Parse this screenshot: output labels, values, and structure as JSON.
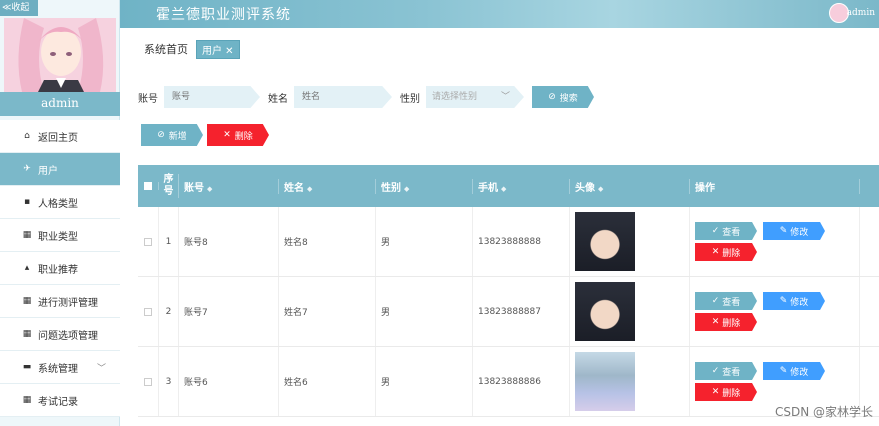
{
  "sidebar": {
    "collapse_label": "≪收起",
    "username": "admin",
    "items": [
      {
        "icon": "home-icon",
        "glyph": "⌂",
        "label": "返回主页"
      },
      {
        "icon": "send-icon",
        "glyph": "✈",
        "label": "用户"
      },
      {
        "icon": "document-icon",
        "glyph": "▪",
        "label": "人格类型"
      },
      {
        "icon": "grid-icon",
        "glyph": "▦",
        "label": "职业类型"
      },
      {
        "icon": "thumb-icon",
        "glyph": "▴",
        "label": "职业推荐"
      },
      {
        "icon": "grid-icon",
        "glyph": "▦",
        "label": "进行测评管理"
      },
      {
        "icon": "grid-icon",
        "glyph": "▦",
        "label": "问题选项管理"
      },
      {
        "icon": "message-icon",
        "glyph": "▬",
        "label": "系统管理"
      },
      {
        "icon": "grid-icon",
        "glyph": "▦",
        "label": "考试记录"
      }
    ],
    "active_index": 1
  },
  "header": {
    "title": "霍兰德职业测评系统",
    "user": "admin"
  },
  "breadcrumb": {
    "home": "系统首页",
    "tag": "用户 ✕"
  },
  "search": {
    "account_label": "账号",
    "account_placeholder": "账号",
    "name_label": "姓名",
    "name_placeholder": "姓名",
    "sex_label": "性别",
    "sex_placeholder": "请选择性别",
    "search_button": "搜索"
  },
  "actions": {
    "add": "新增",
    "delete": "删除"
  },
  "table": {
    "headers": {
      "no": "序号",
      "account": "账号",
      "name": "姓名",
      "sex": "性别",
      "phone": "手机",
      "avatar": "头像",
      "ops": "操作"
    },
    "rows": [
      {
        "no": "1",
        "account": "账号8",
        "name": "姓名8",
        "sex": "男",
        "phone": "13823888888",
        "avatar": "dark"
      },
      {
        "no": "2",
        "account": "账号7",
        "name": "姓名7",
        "sex": "男",
        "phone": "13823888887",
        "avatar": "dark"
      },
      {
        "no": "3",
        "account": "账号6",
        "name": "姓名6",
        "sex": "男",
        "phone": "13823888886",
        "avatar": "girl"
      }
    ],
    "row_ops": {
      "view": "查看",
      "edit": "修改",
      "delete": "删除"
    }
  },
  "watermark": "CSDN @家林学长",
  "colors": {
    "primary": "#7bb8c9",
    "danger": "#f5222d",
    "edit": "#409eff"
  }
}
